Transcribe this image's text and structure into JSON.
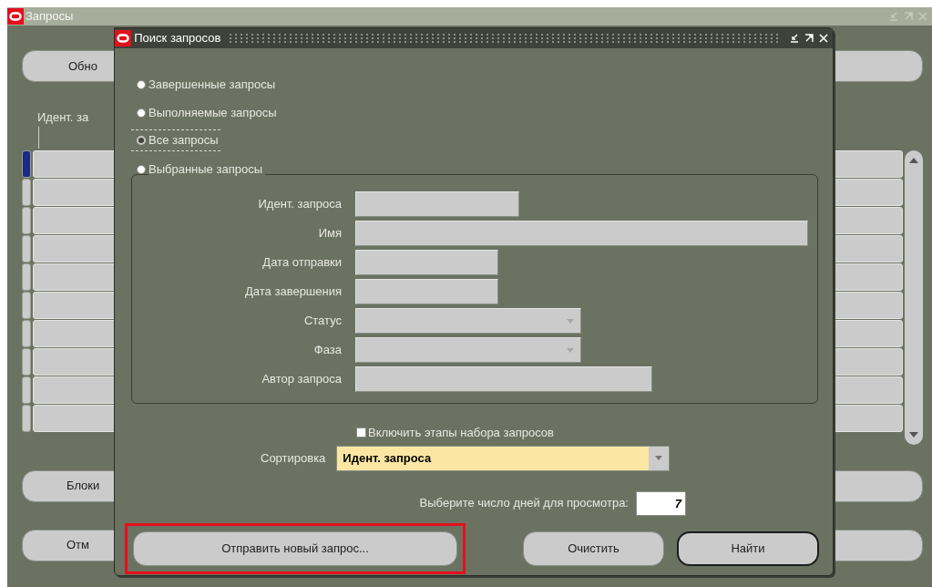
{
  "main_window": {
    "title": "Запросы",
    "top_button": {
      "label": "Обно"
    },
    "column_header": "Идент. за",
    "rows": [
      {
        "selected": true
      },
      {
        "selected": false
      },
      {
        "selected": false
      },
      {
        "selected": false
      },
      {
        "selected": false
      },
      {
        "selected": false
      },
      {
        "selected": false
      },
      {
        "selected": false
      },
      {
        "selected": false
      },
      {
        "selected": false
      }
    ],
    "bottom_buttons": [
      {
        "label": "Блоки"
      },
      {
        "label": "Отм"
      }
    ]
  },
  "dialog": {
    "title": "Поиск запросов",
    "radios": [
      {
        "label": "Завершенные запросы",
        "selected": false
      },
      {
        "label": "Выполняемые запросы",
        "selected": false
      },
      {
        "label": "Все запросы",
        "selected": true
      },
      {
        "label": "Выбранные запросы",
        "selected": false
      }
    ],
    "fields": [
      {
        "label": "Идент. запроса",
        "kind": "text"
      },
      {
        "label": "Имя",
        "kind": "text"
      },
      {
        "label": "Дата отправки",
        "kind": "text"
      },
      {
        "label": "Дата завершения",
        "kind": "text"
      },
      {
        "label": "Статус",
        "kind": "select"
      },
      {
        "label": "Фаза",
        "kind": "select"
      },
      {
        "label": "Автор запроса",
        "kind": "text"
      }
    ],
    "include_stages": {
      "label": "Включить этапы набора запросов",
      "checked": false
    },
    "sort": {
      "label": "Сортировка",
      "value": "Идент. запроса"
    },
    "days": {
      "label": "Выберите число дней для просмотра:",
      "value": "7"
    },
    "buttons": [
      {
        "label": "Отправить новый запрос...",
        "kind": "normal",
        "highlighted": true
      },
      {
        "label": "Очистить",
        "kind": "normal",
        "highlighted": false
      },
      {
        "label": "Найти",
        "kind": "default",
        "highlighted": false
      }
    ]
  }
}
